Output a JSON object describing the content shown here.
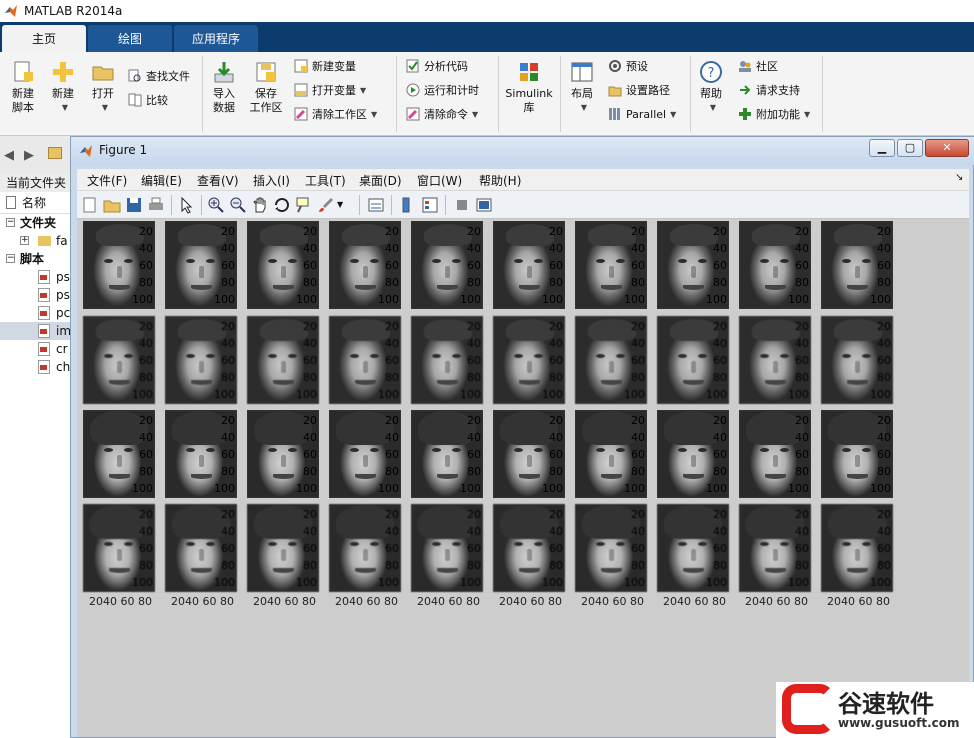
{
  "app": {
    "title": "MATLAB R2014a"
  },
  "tabs": [
    "主页",
    "绘图",
    "应用程序"
  ],
  "ribbon": {
    "new_script": [
      "新建",
      "脚本"
    ],
    "new": "新建",
    "open": "打开",
    "find_files": "查找文件",
    "compare": "比较",
    "import_data": [
      "导入",
      "数据"
    ],
    "save_workspace": [
      "保存",
      "工作区"
    ],
    "new_variable": "新建变量",
    "open_variable": "打开变量",
    "clear_workspace": "清除工作区",
    "analyze_code": "分析代码",
    "run_and_time": "运行和计时",
    "clear_commands": "清除命令",
    "simulink": [
      "Simulink",
      "库"
    ],
    "layout": "布局",
    "preferences": "预设",
    "set_path": "设置路径",
    "parallel": "Parallel",
    "help": "帮助",
    "community": "社区",
    "request_support": "请求支持",
    "addons": "附加功能"
  },
  "file_browser": {
    "current_folder_label": "当前文件夹",
    "column_name": "名称",
    "folders_group": "文件夹",
    "folder_item": "fa",
    "scripts_group": "脚本",
    "scripts": [
      "ps",
      "ps",
      "pc",
      "im",
      "cr",
      "ch"
    ],
    "selected_index": 3
  },
  "figure": {
    "title": "Figure 1",
    "menus": [
      "文件(F)",
      "编辑(E)",
      "查看(V)",
      "插入(I)",
      "工具(T)",
      "桌面(D)",
      "窗口(W)",
      "帮助(H)"
    ],
    "y_ticks": [
      "20",
      "40",
      "60",
      "80",
      "100"
    ],
    "x_ticks": "2040 60 80",
    "rows": 4,
    "cols": 10
  },
  "watermark": {
    "name": "谷速软件",
    "url": "www.gusuoft.com"
  }
}
